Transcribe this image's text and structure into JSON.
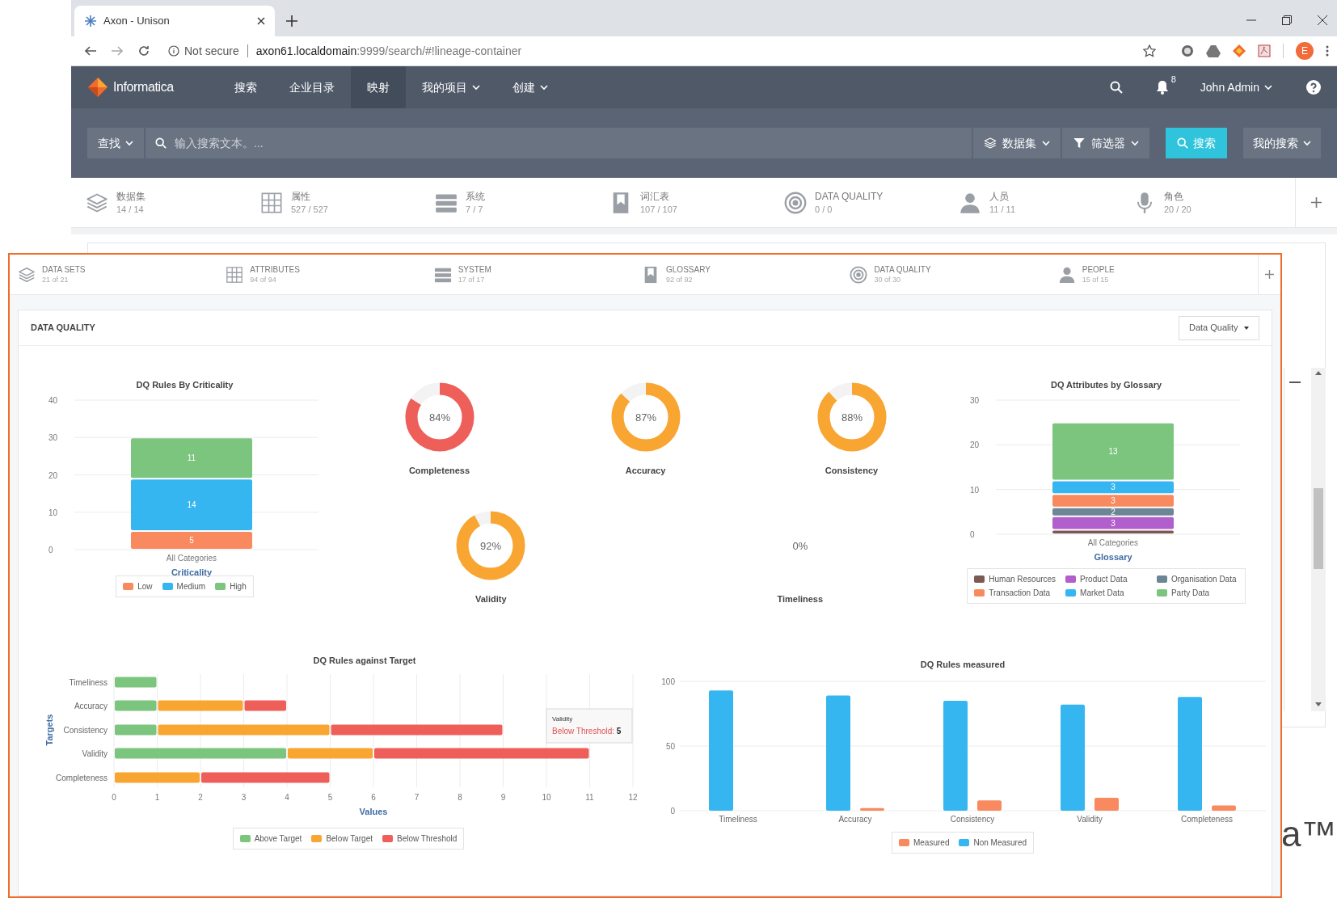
{
  "browser": {
    "tab_title": "Axon - Unison",
    "security": "Not secure",
    "url_host": "axon61.localdomain",
    "url_rest": ":9999/search/#!lineage-container",
    "profile_initial": "E"
  },
  "app_nav": {
    "logo": "Informatica",
    "items": [
      {
        "label": "搜索",
        "selected": false,
        "dropdown": false
      },
      {
        "label": "企业目录",
        "selected": false,
        "dropdown": false
      },
      {
        "label": "映射",
        "selected": true,
        "dropdown": false
      },
      {
        "label": "我的项目",
        "selected": false,
        "dropdown": true
      },
      {
        "label": "创建",
        "selected": false,
        "dropdown": true
      }
    ],
    "notification_count": "8",
    "user": "John Admin"
  },
  "search_bar": {
    "scope": "查找",
    "placeholder": "输入搜索文本。...",
    "filters": [
      {
        "label": "数据集",
        "kind": "layers"
      },
      {
        "label": "筛选器",
        "kind": "filter"
      }
    ],
    "search_button": "搜索",
    "saved_searches": "我的搜索"
  },
  "facets": [
    {
      "label": "数据集",
      "count": "14 / 14",
      "kind": "layers"
    },
    {
      "label": "属性",
      "count": "527 / 527",
      "kind": "grid"
    },
    {
      "label": "系统",
      "count": "7 / 7",
      "kind": "server"
    },
    {
      "label": "词汇表",
      "count": "107 / 107",
      "kind": "book"
    },
    {
      "label": "DATA QUALITY",
      "count": "0 / 0",
      "kind": "target"
    },
    {
      "label": "人员",
      "count": "11 / 11",
      "kind": "person"
    },
    {
      "label": "角色",
      "count": "20 / 20",
      "kind": "mic"
    }
  ],
  "background_logo_fragment": "a™",
  "overlay": {
    "facets": [
      {
        "label": "DATA SETS",
        "count": "21 of 21",
        "kind": "layers"
      },
      {
        "label": "ATTRIBUTES",
        "count": "94 of 94",
        "kind": "grid"
      },
      {
        "label": "SYSTEM",
        "count": "17 of 17",
        "kind": "server"
      },
      {
        "label": "GLOSSARY",
        "count": "92 of 92",
        "kind": "book"
      },
      {
        "label": "DATA QUALITY",
        "count": "30 of 30",
        "kind": "target"
      },
      {
        "label": "PEOPLE",
        "count": "15 of 15",
        "kind": "person"
      }
    ],
    "card": {
      "title": "DATA QUALITY",
      "dropdown": "Data Quality",
      "criticality_chart": {
        "chart_data": {
          "type": "bar",
          "title": "DQ Rules By Criticality",
          "xlabel": "Criticality",
          "categories": [
            "All Categories"
          ],
          "stacked": true,
          "grid": true,
          "data_labels": true,
          "ylim": [
            0,
            40
          ],
          "yticks": [
            0,
            10,
            20,
            30,
            40
          ],
          "series": [
            {
              "name": "Low",
              "color": "#f98a5f",
              "values": [
                5
              ]
            },
            {
              "name": "Medium",
              "color": "#35b6f0",
              "values": [
                14
              ]
            },
            {
              "name": "High",
              "color": "#7cc57f",
              "values": [
                11
              ]
            }
          ]
        }
      },
      "scores": [
        {
          "label": "Completeness",
          "value": "84%",
          "level": 0.84,
          "color": "#ef5f5a"
        },
        {
          "label": "Accuracy",
          "value": "87%",
          "level": 0.87,
          "color": "#f9a531"
        },
        {
          "label": "Consistency",
          "value": "88%",
          "level": 0.88,
          "color": "#f9a531"
        },
        {
          "label": "Validity",
          "value": "92%",
          "level": 0.92,
          "color": "#f9a531"
        },
        {
          "label": "Timeliness",
          "value": "0%"
        }
      ],
      "glossary_chart": {
        "chart_data": {
          "type": "bar",
          "title": "DQ Attributes by Glossary",
          "xlabel": "Glossary",
          "categories": [
            "All Categories"
          ],
          "stacked": true,
          "grid": true,
          "ylim": [
            0,
            30
          ],
          "yticks": [
            0,
            10,
            20,
            30
          ],
          "series": [
            {
              "name": "Human Resources",
              "color": "#7a5a52",
              "values": [
                1
              ],
              "value_labels": [
                null
              ]
            },
            {
              "name": "Product Data",
              "color": "#b15fcc",
              "values": [
                3
              ],
              "value_labels": [
                "3"
              ]
            },
            {
              "name": "Organisation Data",
              "color": "#6d8696",
              "values": [
                2
              ],
              "value_labels": [
                "2"
              ]
            },
            {
              "name": "Transaction Data",
              "color": "#f98a5f",
              "values": [
                3
              ],
              "value_labels": [
                "3"
              ]
            },
            {
              "name": "Market Data",
              "color": "#35b6f0",
              "values": [
                3
              ],
              "value_labels": [
                "3"
              ]
            },
            {
              "name": "Party Data",
              "color": "#7cc57f",
              "values": [
                13
              ],
              "value_labels": [
                "13"
              ]
            }
          ]
        }
      },
      "target_chart": {
        "chart_data": {
          "type": "bar",
          "orientation": "horizontal",
          "stacked": true,
          "grid": true,
          "title": "DQ Rules against Target",
          "xlabel": "Values",
          "ylabel": "Targets",
          "categories": [
            "Timeliness",
            "Accuracy",
            "Consistency",
            "Validity",
            "Completeness"
          ],
          "xlim": [
            0,
            12
          ],
          "xticks": [
            0,
            1,
            2,
            3,
            4,
            5,
            6,
            7,
            8,
            9,
            10,
            11,
            12
          ],
          "series": [
            {
              "name": "Above Target",
              "color": "#7cc57f",
              "values": [
                1,
                1,
                1,
                4,
                null
              ]
            },
            {
              "name": "Below Target",
              "color": "#f9a531",
              "values": [
                null,
                2,
                4,
                2,
                2
              ]
            },
            {
              "name": "Below Threshold",
              "color": "#ef5f5a",
              "values": [
                null,
                1,
                4,
                5,
                3
              ]
            }
          ]
        },
        "tooltip": {
          "title": "Validity",
          "label": "Below Threshold:",
          "value": "5"
        }
      },
      "measured_chart": {
        "chart_data": {
          "type": "bar",
          "title": "DQ Rules measured",
          "grid": true,
          "categories": [
            "Timeliness",
            "Accuracy",
            "Consistency",
            "Validity",
            "Completeness"
          ],
          "ylim": [
            0,
            100
          ],
          "yticks": [
            0,
            50,
            100
          ],
          "series": [
            {
              "name": "Measured",
              "color": "#f98a5f",
              "values": [
                0,
                2,
                8,
                10,
                4
              ]
            },
            {
              "name": "Non Measured",
              "color": "#35b6f0",
              "values": [
                93,
                89,
                85,
                82,
                88
              ]
            }
          ]
        }
      }
    }
  }
}
